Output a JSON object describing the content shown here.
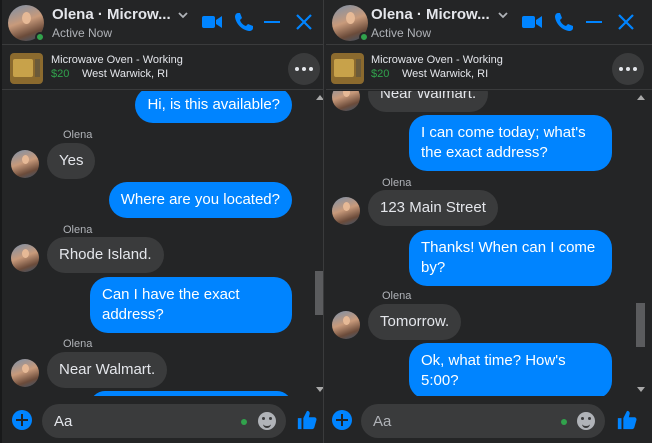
{
  "conversation": {
    "contact_name": "Olena · Microw...",
    "status": "Active Now"
  },
  "listing": {
    "title": "Microwave Oven - Working",
    "price": "$20",
    "location": "West Warwick, RI"
  },
  "left_messages": [
    {
      "dir": "out",
      "text": "Hi, is this available?"
    },
    {
      "dir": "in",
      "sender": "Olena",
      "text": "Yes"
    },
    {
      "dir": "out",
      "text": "Where are you located?"
    },
    {
      "dir": "in",
      "sender": "Olena",
      "text": "Rhode Island."
    },
    {
      "dir": "out",
      "line1": "Can I have the exact",
      "line2": "address?"
    },
    {
      "dir": "in",
      "sender": "Olena",
      "text": "Near Walmart."
    }
  ],
  "right_messages": [
    {
      "dir": "in",
      "text": "Near Walmart."
    },
    {
      "dir": "out",
      "line1": "I can come today; what's",
      "line2": "the exact address?"
    },
    {
      "dir": "in",
      "sender": "Olena",
      "text": "123 Main Street"
    },
    {
      "dir": "out",
      "line1": "Thanks! When can I come",
      "line2": "by?"
    },
    {
      "dir": "in",
      "sender": "Olena",
      "text": "Tomorrow."
    },
    {
      "dir": "out",
      "line1": "Ok, what time? How's",
      "line2": "5:00?"
    }
  ],
  "composer": {
    "left_value": "Aa",
    "right_placeholder": "Aa"
  },
  "colors": {
    "accent": "#0084ff",
    "background": "#242526",
    "bubble_in": "#3a3b3c",
    "online": "#31a24c"
  },
  "icons": [
    "video-icon",
    "phone-icon",
    "minimize-icon",
    "close-icon",
    "chevron-down-icon",
    "more-options-icon",
    "add-icon",
    "emoji-icon",
    "thumbs-up-icon"
  ],
  "scroll": {
    "left_position": 0.62,
    "right_position": 0.82
  }
}
